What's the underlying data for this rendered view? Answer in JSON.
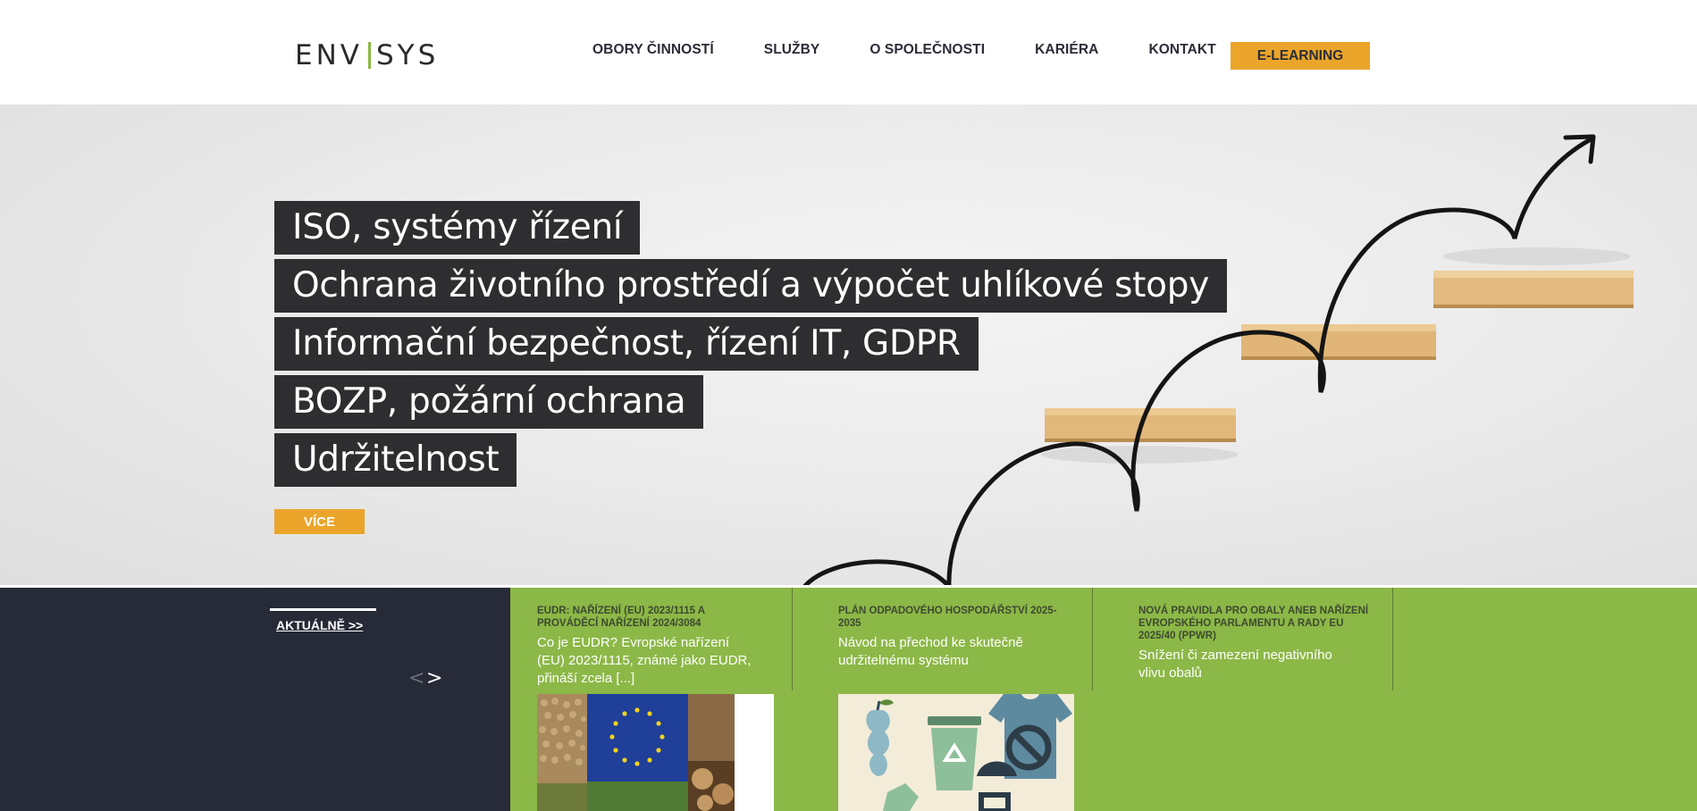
{
  "header": {
    "logo_left": "ENV",
    "logo_right": "SYS",
    "nav": [
      {
        "label": "OBORY ČINNOSTÍ"
      },
      {
        "label": "SLUŽBY"
      },
      {
        "label": "O SPOLEČNOSTI"
      },
      {
        "label": "KARIÉRA"
      },
      {
        "label": "KONTAKT"
      }
    ],
    "elearning_label": "E-LEARNING"
  },
  "hero": {
    "lines": [
      "ISO, systémy řízení",
      "Ochrana životního prostředí a výpočet uhlíkové stopy",
      "Informační bezpečnost, řízení IT, GDPR",
      "BOZP, požární ochrana",
      "Udržitelnost"
    ],
    "button_label": "VÍCE"
  },
  "news": {
    "tab_label": "AKTUÁLNĚ >>",
    "prev_arrow": "<",
    "next_arrow": ">",
    "cards": [
      {
        "title_1": "EUDR: NAŘÍZENÍ (EU) 2023/1115 A",
        "title_2": "PROVÁDĚCÍ NAŘÍZENÍ 2024/3084",
        "title_3": "",
        "text_1": "Co je EUDR? Evropské nařízení",
        "text_2": "(EU) 2023/1115, známé jako EUDR,",
        "text_3": "přináší zcela [...]"
      },
      {
        "title_1": "PLÁN ODPADOVÉHO HOSPODÁŘSTVÍ 2025-",
        "title_2": "2035",
        "title_3": "",
        "text_1": "Návod na přechod ke skutečně",
        "text_2": "udržitelnému systému",
        "text_3": ""
      },
      {
        "title_1": "NOVÁ PRAVIDLA PRO OBALY ANEB NAŘÍZENÍ",
        "title_2": "EVROPSKÉHO PARLAMENTU A RADY EU",
        "title_3": "2025/40 (PPWR)",
        "text_1": "Snížení či zamezení negativního",
        "text_2": "vlivu obalů",
        "text_3": ""
      }
    ]
  },
  "colors": {
    "accent_orange": "#eba52b",
    "green": "#8cb847",
    "dark": "#272a37",
    "hero_label_bg": "#2e2e30"
  }
}
